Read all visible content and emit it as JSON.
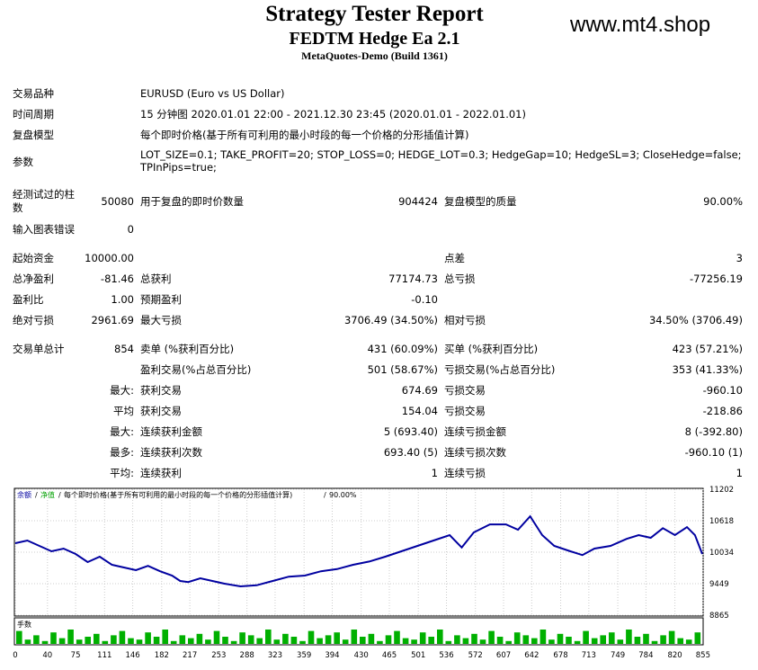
{
  "header": {
    "title": "Strategy Tester Report",
    "ea_name": "FEDTM Hedge Ea 2.1",
    "build": "MetaQuotes-Demo (Build 1361)",
    "watermark": "www.mt4.shop"
  },
  "info": {
    "symbol_label": "交易品种",
    "symbol_value": "EURUSD (Euro vs US Dollar)",
    "period_label": "时间周期",
    "period_value": "15 分钟图 2020.01.01 22:00 - 2021.12.30 23:45 (2020.01.01 - 2022.01.01)",
    "model_label": "复盘模型",
    "model_value": "每个即时价格(基于所有可利用的最小时段的每一个价格的分形插值计算)",
    "params_label": "参数",
    "params_line1": "LOT_SIZE=0.1; TAKE_PROFIT=20; STOP_LOSS=0; HEDGE_LOT=0.3; HedgeGap=10; HedgeSL=3; CloseHedge=false;",
    "params_line2": "TPInPips=true;"
  },
  "stats": {
    "bars_label1": "经测试过的柱",
    "bars_label2": "数",
    "bars_value": "50080",
    "ticks_label": "用于复盘的即时价数量",
    "ticks_value": "904424",
    "quality_label": "复盘模型的质量",
    "quality_value": "90.00%",
    "errors_label": "输入图表错误",
    "errors_value": "0",
    "deposit_label": "起始资金",
    "deposit_value": "10000.00",
    "spread_label": "点差",
    "spread_value": "3",
    "net_label": "总净盈利",
    "net_value": "-81.46",
    "gross_profit_label": "总获利",
    "gross_profit_value": "77174.73",
    "gross_loss_label": "总亏损",
    "gross_loss_value": "-77256.19",
    "pf_label": "盈利比",
    "pf_value": "1.00",
    "expected_label": "预期盈利",
    "expected_value": "-0.10",
    "abs_dd_label": "绝对亏损",
    "abs_dd_value": "2961.69",
    "max_dd_label": "最大亏损",
    "max_dd_value": "3706.49 (34.50%)",
    "rel_dd_label": "相对亏损",
    "rel_dd_value": "34.50% (3706.49)",
    "total_label": "交易单总计",
    "total_value": "854",
    "short_label": "卖单 (%获利百分比)",
    "short_value": "431 (60.09%)",
    "long_label": "买单 (%获利百分比)",
    "long_value": "423 (57.21%)",
    "profit_trades_label": "盈利交易(%占总百分比)",
    "profit_trades_value": "501 (58.67%)",
    "loss_trades_label": "亏损交易(%占总百分比)",
    "loss_trades_value": "353 (41.33%)",
    "largest_prefix": "最大:",
    "largest_profit_label": "获利交易",
    "largest_profit_value": "674.69",
    "largest_loss_label": "亏损交易",
    "largest_loss_value": "-960.10",
    "average_prefix": "平均",
    "average_profit_label": "获利交易",
    "average_profit_value": "154.04",
    "average_loss_label": "亏损交易",
    "average_loss_value": "-218.86",
    "max_cons_prefix": "最大:",
    "max_cons_wins_label": "连续获利金额",
    "max_cons_wins_value": "5 (693.40)",
    "max_cons_losses_label": "连续亏损金额",
    "max_cons_losses_value": "8 (-392.80)",
    "most_cons_prefix": "最多:",
    "most_cons_profit_label": "连续获利次数",
    "most_cons_profit_value": "693.40 (5)",
    "most_cons_loss_label": "连续亏损次数",
    "most_cons_loss_value": "-960.10 (1)",
    "avg_cons_prefix": "平均:",
    "avg_cons_wins_label": "连续获利",
    "avg_cons_wins_value": "1",
    "avg_cons_losses_label": "连续亏损",
    "avg_cons_losses_value": "1"
  },
  "chart_data": {
    "type": "line",
    "legend": [
      "余额",
      "净值",
      "每个即时价格(基于所有可利用的最小时段的每一个价格的分形插值计算)",
      "90.00%"
    ],
    "volume_label": "手数",
    "x_ticks": [
      0,
      40,
      75,
      111,
      146,
      182,
      217,
      253,
      288,
      323,
      359,
      394,
      430,
      465,
      501,
      536,
      572,
      607,
      642,
      678,
      713,
      749,
      784,
      820,
      855
    ],
    "y_ticks": [
      11202,
      10618,
      10034,
      9449,
      8865
    ],
    "xlim": [
      0,
      854
    ],
    "ylim": [
      8865,
      11202
    ],
    "series": [
      {
        "name": "余额",
        "color": "#0000a0",
        "x": [
          0,
          15,
          30,
          45,
          60,
          75,
          90,
          105,
          120,
          135,
          150,
          165,
          180,
          195,
          205,
          215,
          230,
          245,
          260,
          280,
          300,
          320,
          340,
          360,
          380,
          400,
          420,
          440,
          460,
          480,
          500,
          520,
          540,
          555,
          570,
          590,
          610,
          625,
          640,
          655,
          670,
          690,
          705,
          720,
          740,
          760,
          775,
          790,
          805,
          820,
          835,
          845,
          854
        ],
        "y": [
          10200,
          10250,
          10150,
          10050,
          10100,
          10000,
          9850,
          9950,
          9800,
          9750,
          9700,
          9780,
          9680,
          9600,
          9500,
          9480,
          9550,
          9500,
          9450,
          9400,
          9420,
          9500,
          9580,
          9600,
          9680,
          9720,
          9800,
          9860,
          9950,
          10050,
          10150,
          10250,
          10350,
          10120,
          10400,
          10550,
          10550,
          10450,
          10700,
          10350,
          10150,
          10050,
          9980,
          10100,
          10150,
          10280,
          10350,
          10300,
          10480,
          10350,
          10500,
          10350,
          10000
        ]
      }
    ],
    "volume": {
      "color": "#00b000",
      "ylim": [
        0,
        1
      ],
      "values": [
        0.9,
        0.3,
        0.6,
        0.2,
        0.8,
        0.4,
        1.0,
        0.3,
        0.5,
        0.7,
        0.2,
        0.6,
        0.9,
        0.4,
        0.3,
        0.8,
        0.5,
        1.0,
        0.2,
        0.6,
        0.4,
        0.7,
        0.3,
        0.9,
        0.5,
        0.2,
        0.8,
        0.6,
        0.4,
        1.0,
        0.3,
        0.7,
        0.5,
        0.2,
        0.9,
        0.4,
        0.6,
        0.8,
        0.3,
        1.0,
        0.5,
        0.7,
        0.2,
        0.6,
        0.9,
        0.4,
        0.3,
        0.8,
        0.5,
        1.0,
        0.2,
        0.6,
        0.4,
        0.7,
        0.3,
        0.9,
        0.5,
        0.2,
        0.8,
        0.6,
        0.4,
        1.0,
        0.3,
        0.7,
        0.5,
        0.2,
        0.9,
        0.4,
        0.6,
        0.8,
        0.3,
        1.0,
        0.5,
        0.7,
        0.2,
        0.6,
        0.9,
        0.4,
        0.3,
        0.8
      ]
    }
  }
}
